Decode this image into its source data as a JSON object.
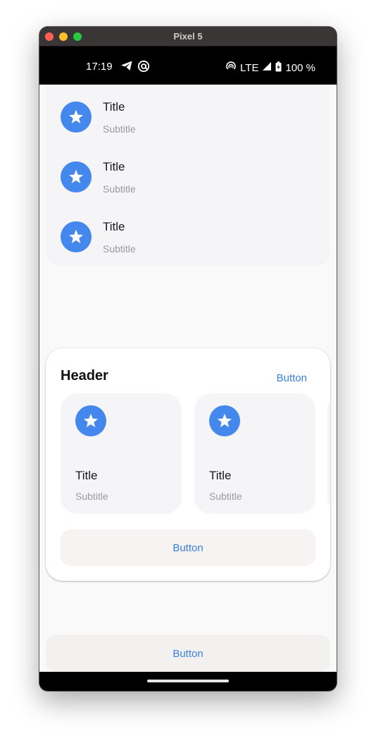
{
  "window": {
    "title": "Pixel 5"
  },
  "status_bar": {
    "time": "17:19",
    "network": "LTE",
    "battery": "100 %"
  },
  "list": {
    "items": [
      {
        "title": "Title",
        "subtitle": "Subtitle",
        "icon": "star-icon"
      },
      {
        "title": "Title",
        "subtitle": "Subtitle",
        "icon": "star-icon"
      },
      {
        "title": "Title",
        "subtitle": "Subtitle",
        "icon": "star-icon"
      }
    ]
  },
  "header_card": {
    "header": "Header",
    "action_label": "Button",
    "tiles": [
      {
        "title": "Title",
        "subtitle": "Subtitle",
        "icon": "star-icon"
      },
      {
        "title": "Title",
        "subtitle": "Subtitle",
        "icon": "star-icon"
      }
    ],
    "wide_button_label": "Button"
  },
  "bottom_button": {
    "label": "Button"
  },
  "colors": {
    "accent": "#4488ee",
    "link": "#3a82d8"
  }
}
